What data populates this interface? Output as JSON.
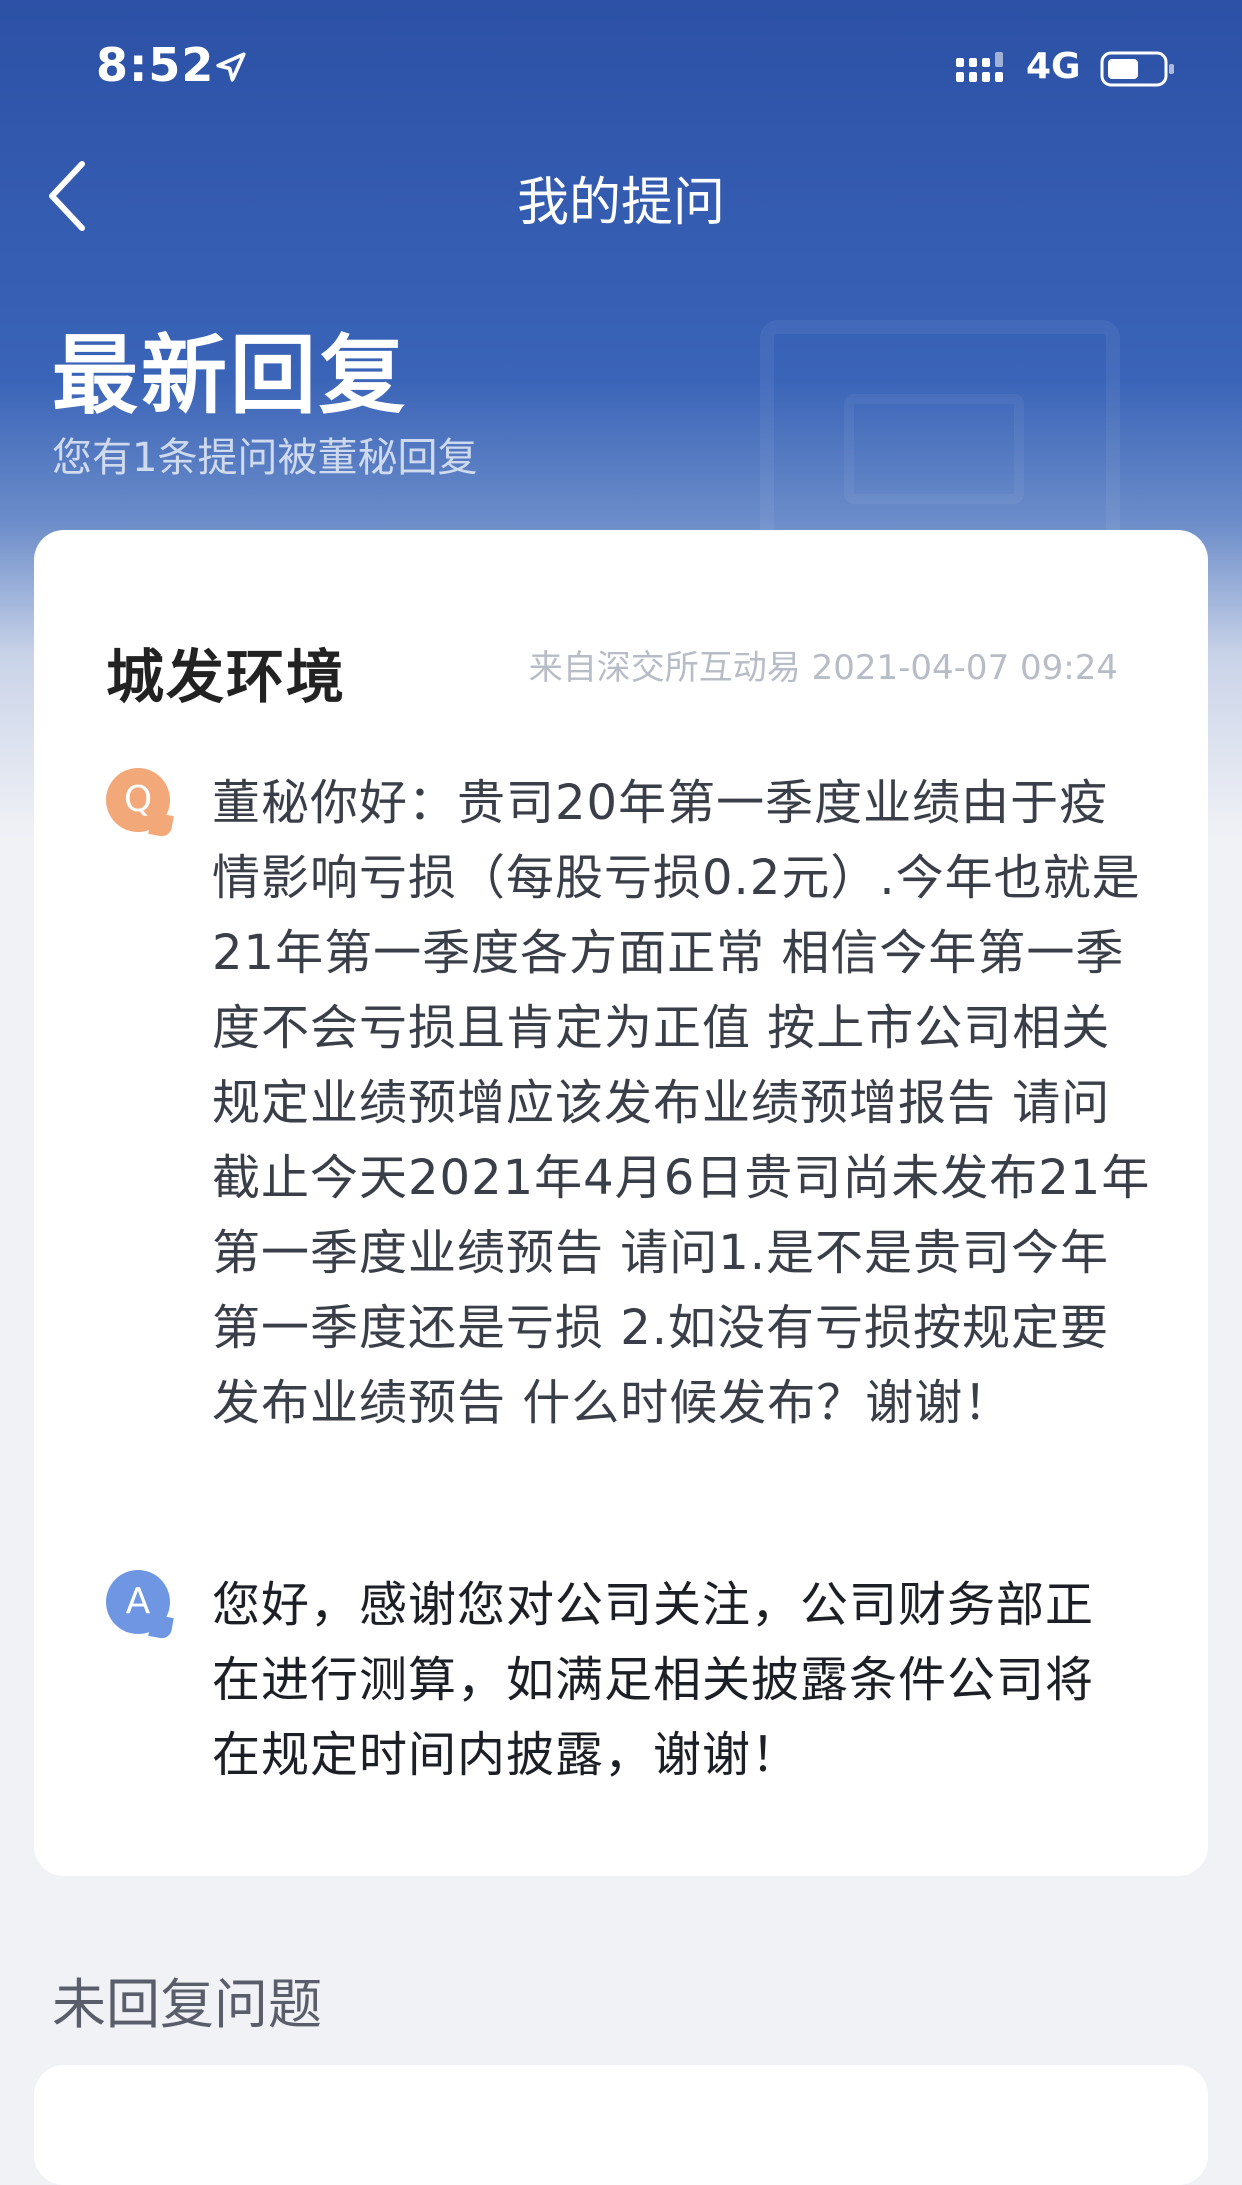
{
  "status_bar": {
    "time": "8:52",
    "network": "4G",
    "icons": [
      "location-arrow-icon",
      "signal-icon",
      "battery-icon"
    ]
  },
  "nav": {
    "title": "我的提问",
    "back_icon": "chevron-left-icon"
  },
  "hero": {
    "title": "最新回复",
    "subtitle": "您有1条提问被董秘回复"
  },
  "reply_card": {
    "company": "城发环境",
    "source": "来自深交所互动易 2021-04-07 09:24",
    "question_badge": "Q",
    "question": "董秘你好：贵司20年第一季度业绩由于疫情影响亏损（每股亏损0.2元）.今年也就是21年第一季度各方面正常 相信今年第一季度不会亏损且肯定为正值 按上市公司相关规定业绩预增应该发布业绩预增报告 请问 截止今天2021年4月6日贵司尚未发布21年第一季度业绩预告 请问1.是不是贵司今年第一季度还是亏损 2.如没有亏损按规定要发布业绩预告 什么时候发布？谢谢！",
    "answer_badge": "A",
    "answer": "您好，感谢您对公司关注，公司财务部正在进行测算，如满足相关披露条件公司将在规定时间内披露，谢谢！"
  },
  "unanswered": {
    "title": "未回复问题"
  },
  "colors": {
    "header_blue": "#2c51a6",
    "q_badge": "#f2a878",
    "a_badge": "#6e96e3",
    "page_bg": "#f1f2f6"
  }
}
